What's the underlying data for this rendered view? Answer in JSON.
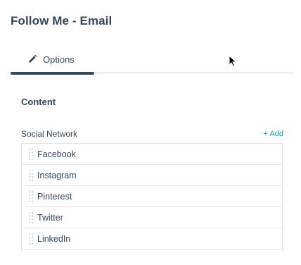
{
  "module": {
    "title": "Follow Me - Email"
  },
  "tabs": [
    {
      "label": "Options",
      "icon": "pencil-icon",
      "active": true
    }
  ],
  "content": {
    "section_title": "Content",
    "field_label": "Social Network",
    "add_label": "+ Add",
    "items": [
      {
        "label": "Facebook"
      },
      {
        "label": "Instagram"
      },
      {
        "label": "Pinterest"
      },
      {
        "label": "Twitter"
      },
      {
        "label": "LinkedIn"
      }
    ]
  },
  "colors": {
    "text": "#33475b",
    "accent_link": "#00a4bd",
    "border": "#dfe3eb",
    "tab_underline": "#33475b"
  }
}
